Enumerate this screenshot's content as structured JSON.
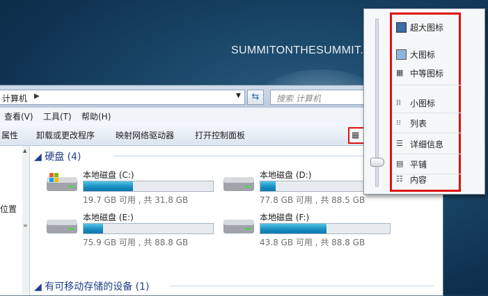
{
  "site_text": "SUMMITONTHESUMMIT.",
  "address_bar": {
    "path": "计算机",
    "search_placeholder": "搜索 计算机"
  },
  "menubar": {
    "items": [
      "查看(V)",
      "工具(T)",
      "帮助(H)"
    ]
  },
  "toolbar": {
    "items": [
      "属性",
      "卸载或更改程序",
      "映射网络驱动器",
      "打开控制面板"
    ]
  },
  "nav_pane": {
    "visible_label": "位置"
  },
  "hard_disks_group": {
    "header": "硬盘 (4)",
    "drives": [
      {
        "name": "本地磁盘 (C:)",
        "info": "19.7 GB 可用 , 共 31.8 GB",
        "used_fraction": 0.38
      },
      {
        "name": "本地磁盘 (D:)",
        "info": "77.8 GB 可用 , 共 88.5 GB",
        "used_fraction": 0.12
      },
      {
        "name": "本地磁盘 (E:)",
        "info": "75.9 GB 可用 , 共 88.8 GB",
        "used_fraction": 0.15
      },
      {
        "name": "本地磁盘 (F:)",
        "info": "43.8 GB 可用 , 共 88.8 GB",
        "used_fraction": 0.51
      }
    ]
  },
  "removable_group": {
    "header": "有可移动存储的设备 (1)"
  },
  "view_menu": {
    "options": [
      {
        "label": "超大图标",
        "icon": "extra-large-icons-icon"
      },
      {
        "label": "大图标",
        "icon": "large-icons-icon"
      },
      {
        "label": "中等图标",
        "icon": "medium-icons-icon"
      },
      {
        "label": "小图标",
        "icon": "small-icons-icon"
      },
      {
        "label": "列表",
        "icon": "list-icon"
      },
      {
        "label": "详细信息",
        "icon": "details-icon"
      },
      {
        "label": "平铺",
        "icon": "tiles-icon"
      },
      {
        "label": "内容",
        "icon": "content-icon"
      }
    ],
    "selected": "平铺"
  },
  "colors": {
    "highlight_border": "#e01010",
    "drive_fill": "#1a8fc2",
    "group_header": "#1e3f8a"
  }
}
